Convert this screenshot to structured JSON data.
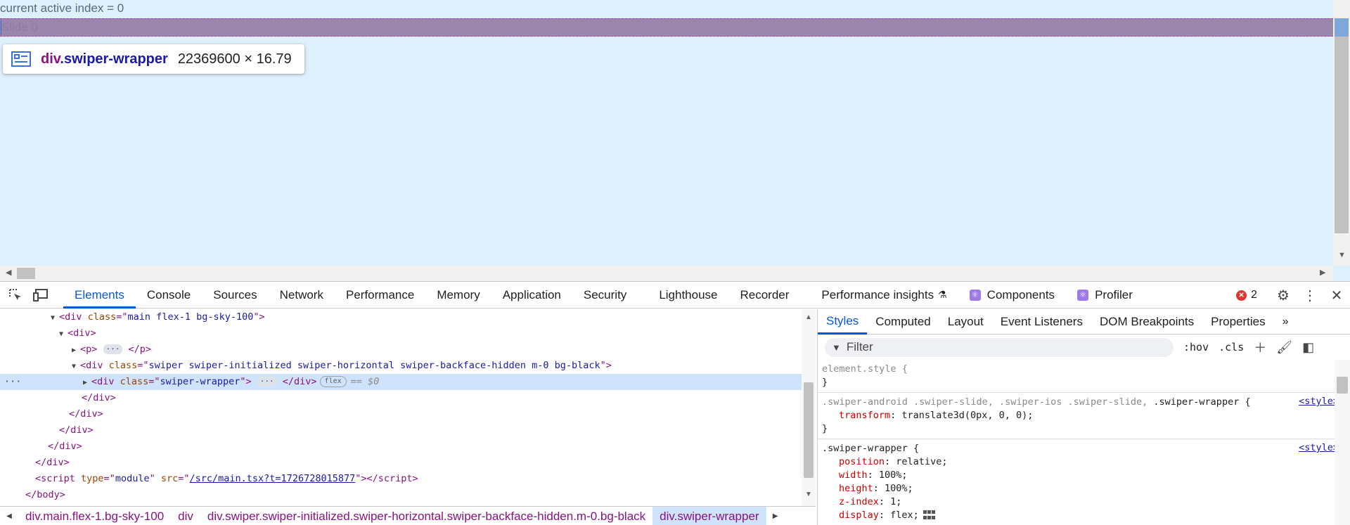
{
  "page": {
    "index_text": "current active index = 0",
    "slide_text": "Slide 0"
  },
  "tooltip": {
    "element_tag": "div",
    "element_class": ".swiper-wrapper",
    "size": "22369600 × 16.79"
  },
  "devtools": {
    "tabs": [
      "Elements",
      "Console",
      "Sources",
      "Network",
      "Performance",
      "Memory",
      "Application",
      "Security",
      "Lighthouse",
      "Recorder",
      "Performance insights",
      "Components",
      "Profiler"
    ],
    "active_tab": "Elements",
    "error_count": "2"
  },
  "tree": {
    "l1_class": "main flex-1 bg-sky-100",
    "l4_class": "swiper swiper-initialized swiper-horizontal swiper-backface-hidden m-0 bg-black",
    "l5_class": "swiper-wrapper",
    "flex_badge": "flex",
    "dollar0": "== $0",
    "script_type": "module",
    "script_src": "/src/main.tsx?t=1726728015877"
  },
  "breadcrumbs": [
    "div.main.flex-1.bg-sky-100",
    "div",
    "div.swiper.swiper-initialized.swiper-horizontal.swiper-backface-hidden.m-0.bg-black",
    "div.swiper-wrapper"
  ],
  "styles": {
    "tabs": [
      "Styles",
      "Computed",
      "Layout",
      "Event Listeners",
      "DOM Breakpoints",
      "Properties"
    ],
    "active_tab": "Styles",
    "filter_placeholder": "Filter",
    "hov": ":hov",
    "cls": ".cls",
    "element_style": "element.style {",
    "rule1_selector_grey": ".swiper-android .swiper-slide, .swiper-ios .swiper-slide, ",
    "rule1_selector": ".swiper-wrapper {",
    "rule1_prop": "transform",
    "rule1_value": "translate3d(0px, 0, 0);",
    "rule2_selector": ".swiper-wrapper {",
    "rule2_props": [
      {
        "name": "position",
        "value": "relative;"
      },
      {
        "name": "width",
        "value": "100%;"
      },
      {
        "name": "height",
        "value": "100%;"
      },
      {
        "name": "z-index",
        "value": "1;"
      },
      {
        "name": "display",
        "value": "flex;"
      }
    ],
    "source": "<style>",
    "close_brace": "}"
  }
}
